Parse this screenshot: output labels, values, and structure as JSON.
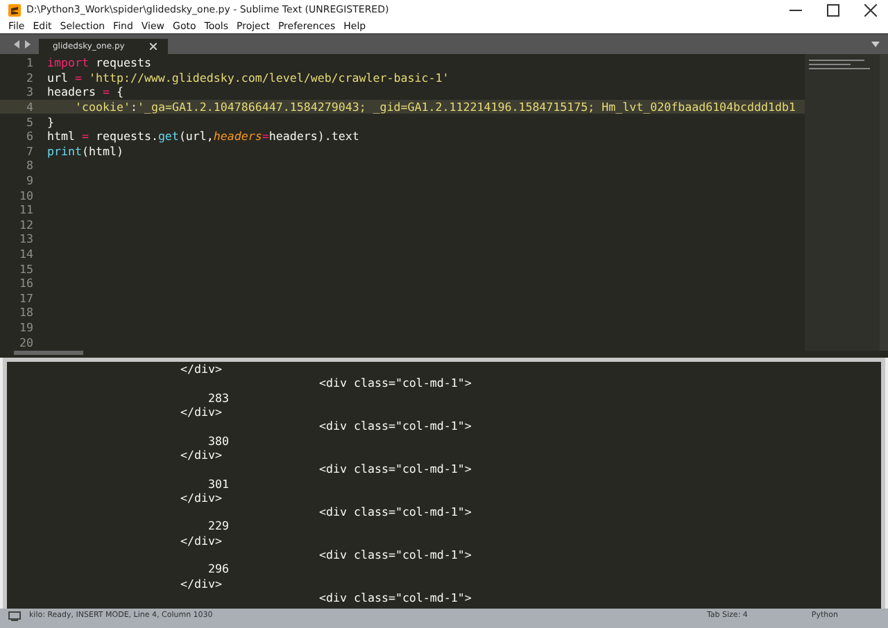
{
  "window": {
    "title": "D:\\Python3_Work\\spider\\glidedsky_one.py - Sublime Text (UNREGISTERED)"
  },
  "menu": [
    "File",
    "Edit",
    "Selection",
    "Find",
    "View",
    "Goto",
    "Tools",
    "Project",
    "Preferences",
    "Help"
  ],
  "tabs": [
    {
      "label": "glidedsky_one.py",
      "selected": true
    }
  ],
  "editor": {
    "lines": [
      {
        "number": "1",
        "current": false,
        "tokens": [
          {
            "text": "import",
            "kind": "keyword"
          },
          {
            "text": " requests",
            "kind": "plain"
          }
        ]
      },
      {
        "number": "2",
        "current": false,
        "tokens": [
          {
            "text": "url ",
            "kind": "plain"
          },
          {
            "text": "=",
            "kind": "keyword"
          },
          {
            "text": " 'http://www.glidedsky.com/level/web/crawler-basic-1'",
            "kind": "string"
          }
        ]
      },
      {
        "number": "3",
        "current": false,
        "tokens": [
          {
            "text": "headers ",
            "kind": "plain"
          },
          {
            "text": "=",
            "kind": "keyword"
          },
          {
            "text": " {",
            "kind": "plain"
          }
        ]
      },
      {
        "number": "4",
        "current": true,
        "indented": true,
        "tokens": [
          {
            "text": "'cookie'",
            "kind": "string"
          },
          {
            "text": ":",
            "kind": "plain"
          },
          {
            "text": "'_ga=GA1.2.1047866447.1584279043; _gid=GA1.2.112214196.1584715175; Hm_lvt_020fbaad6104bcddd1db1",
            "kind": "string"
          }
        ]
      },
      {
        "number": "5",
        "current": false,
        "tokens": [
          {
            "text": "}",
            "kind": "plain"
          }
        ]
      },
      {
        "number": "6",
        "current": false,
        "tokens": [
          {
            "text": "html ",
            "kind": "plain"
          },
          {
            "text": "=",
            "kind": "keyword"
          },
          {
            "text": " requests.",
            "kind": "plain"
          },
          {
            "text": "get",
            "kind": "function"
          },
          {
            "text": "(url,",
            "kind": "plain"
          },
          {
            "text": "headers",
            "kind": "parameter"
          },
          {
            "text": "=",
            "kind": "keyword"
          },
          {
            "text": "headers).text",
            "kind": "plain"
          }
        ]
      },
      {
        "number": "7",
        "current": false,
        "tokens": [
          {
            "text": "print",
            "kind": "function"
          },
          {
            "text": "(html)",
            "kind": "plain"
          }
        ]
      },
      {
        "number": "8",
        "current": false
      },
      {
        "number": "9",
        "current": false
      },
      {
        "number": "10",
        "current": false
      },
      {
        "number": "11",
        "current": false
      },
      {
        "number": "12",
        "current": false
      },
      {
        "number": "13",
        "current": false
      },
      {
        "number": "14",
        "current": false
      },
      {
        "number": "15",
        "current": false
      },
      {
        "number": "16",
        "current": false
      },
      {
        "number": "17",
        "current": false
      },
      {
        "number": "18",
        "current": false
      },
      {
        "number": "19",
        "current": false
      },
      {
        "number": "20",
        "current": false
      }
    ]
  },
  "output": {
    "lines": [
      {
        "text": "</div>",
        "kind": "close"
      },
      {
        "text": "<div class=\"col-md-1\">",
        "kind": "open"
      },
      {
        "text": "283",
        "kind": "value"
      },
      {
        "text": "</div>",
        "kind": "close"
      },
      {
        "text": "<div class=\"col-md-1\">",
        "kind": "open"
      },
      {
        "text": "380",
        "kind": "value"
      },
      {
        "text": "</div>",
        "kind": "close"
      },
      {
        "text": "<div class=\"col-md-1\">",
        "kind": "open"
      },
      {
        "text": "301",
        "kind": "value"
      },
      {
        "text": "</div>",
        "kind": "close"
      },
      {
        "text": "<div class=\"col-md-1\">",
        "kind": "open"
      },
      {
        "text": "229",
        "kind": "value"
      },
      {
        "text": "</div>",
        "kind": "close"
      },
      {
        "text": "<div class=\"col-md-1\">",
        "kind": "open"
      },
      {
        "text": "296",
        "kind": "value"
      },
      {
        "text": "</div>",
        "kind": "close"
      },
      {
        "text": "<div class=\"col-md-1\">",
        "kind": "open"
      }
    ]
  },
  "status_bar": {
    "message": "kilo: Ready, INSERT MODE, Line 4, Column 1030",
    "tab_size": "Tab Size: 4",
    "syntax": "Python"
  }
}
